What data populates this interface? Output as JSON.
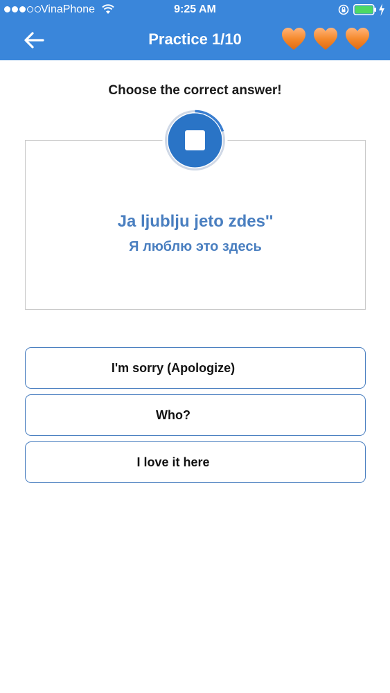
{
  "status_bar": {
    "carrier": "VinaPhone",
    "time": "9:25 AM",
    "signal_bars_filled": 3,
    "signal_bars_total": 5
  },
  "header": {
    "title": "Practice 1/10",
    "back_icon": "arrow-left-icon",
    "lives": 3,
    "life_icon": "heart-icon",
    "life_color": "#f07a1e"
  },
  "question": {
    "prompt": "Choose the correct answer!",
    "phrase_latin": "Ja ljublju jeto zdes''",
    "phrase_cyrillic": "Я люблю это здесь",
    "audio_icon": "stop-icon",
    "audio_progress": 0.2
  },
  "options": [
    {
      "label": "I'm sorry (Apologize)"
    },
    {
      "label": "Who?"
    },
    {
      "label": "I love it here"
    }
  ],
  "colors": {
    "header_bg": "#3a86da",
    "accent": "#4a7fc0",
    "audio_button": "#2a74c6"
  }
}
